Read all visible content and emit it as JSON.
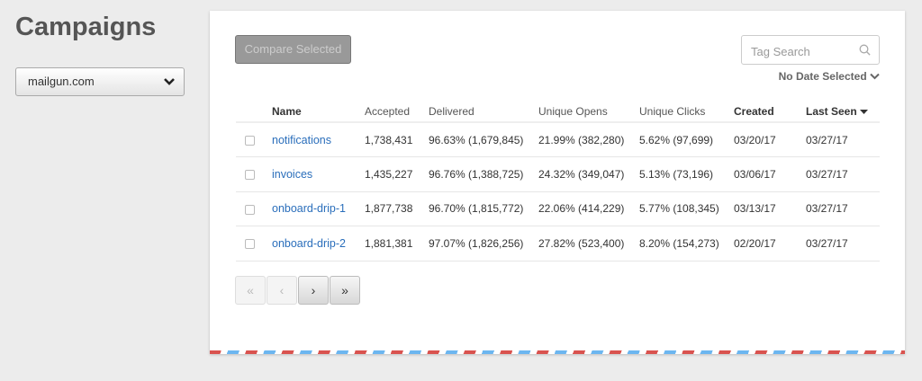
{
  "page_title": "Campaigns",
  "domain_select": {
    "value": "mailgun.com"
  },
  "toolbar": {
    "compare_label": "Compare Selected",
    "tag_search_placeholder": "Tag Search",
    "date_filter": "No Date Selected"
  },
  "table": {
    "headers": [
      "Name",
      "Accepted",
      "Delivered",
      "Unique Opens",
      "Unique Clicks",
      "Created",
      "Last Seen"
    ],
    "rows": [
      [
        "notifications",
        "1,738,431",
        "96.63% (1,679,845)",
        "21.99% (382,280)",
        "5.62% (97,699)",
        "03/20/17",
        "03/27/17"
      ],
      [
        "invoices",
        "1,435,227",
        "96.76% (1,388,725)",
        "24.32% (349,047)",
        "5.13% (73,196)",
        "03/06/17",
        "03/27/17"
      ],
      [
        "onboard-drip-1",
        "1,877,738",
        "96.70% (1,815,772)",
        "22.06% (414,229)",
        "5.77% (108,345)",
        "03/13/17",
        "03/27/17"
      ],
      [
        "onboard-drip-2",
        "1,881,381",
        "97.07% (1,826,256)",
        "27.82% (523,400)",
        "8.20% (154,273)",
        "02/20/17",
        "03/27/17"
      ]
    ]
  },
  "pager": {
    "first": "«",
    "prev": "‹",
    "next": "›",
    "last": "»"
  }
}
